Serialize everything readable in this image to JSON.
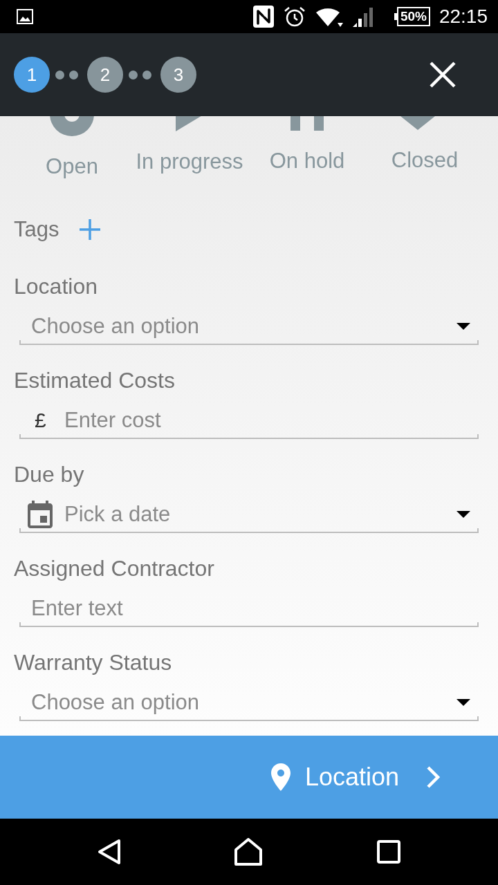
{
  "status_bar": {
    "battery": "50%",
    "time": "22:15"
  },
  "stepper": {
    "steps": [
      {
        "label": "1",
        "selected": true
      },
      {
        "label": "2",
        "selected": false
      },
      {
        "label": "3",
        "selected": false
      }
    ]
  },
  "statuses": [
    {
      "kind": "open",
      "label": "Open"
    },
    {
      "kind": "in_progress",
      "label": "In progress"
    },
    {
      "kind": "on_hold",
      "label": "On hold"
    },
    {
      "kind": "closed",
      "label": "Closed"
    }
  ],
  "tags": {
    "label": "Tags"
  },
  "fields": [
    {
      "kind": "select",
      "label": "Location",
      "placeholder": "Choose an option"
    },
    {
      "kind": "currency",
      "label": "Estimated Costs",
      "prefix": "£",
      "placeholder": "Enter cost"
    },
    {
      "kind": "date",
      "label": "Due by",
      "placeholder": "Pick a date"
    },
    {
      "kind": "text",
      "label": "Assigned Contractor",
      "placeholder": "Enter text"
    },
    {
      "kind": "select",
      "label": "Warranty Status",
      "placeholder": "Choose an option"
    }
  ],
  "footer": {
    "next_button": "Location"
  }
}
